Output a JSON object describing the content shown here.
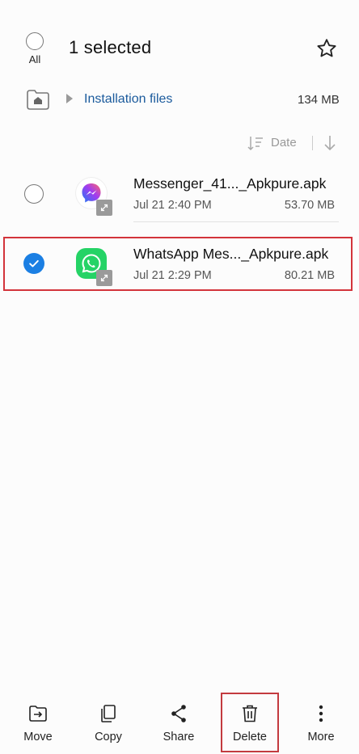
{
  "header": {
    "select_all_label": "All",
    "title": "1 selected"
  },
  "breadcrumb": {
    "folder": "Installation files",
    "size": "134 MB"
  },
  "sort": {
    "label": "Date"
  },
  "files": [
    {
      "name": "Messenger_41..._Apkpure.apk",
      "date": "Jul 21 2:40 PM",
      "size": "53.70 MB",
      "selected": false,
      "icon": "messenger-icon"
    },
    {
      "name": "WhatsApp Mes..._Apkpure.apk",
      "date": "Jul 21 2:29 PM",
      "size": "80.21 MB",
      "selected": true,
      "icon": "whatsapp-icon"
    }
  ],
  "bottom_bar": {
    "move": "Move",
    "copy": "Copy",
    "share": "Share",
    "delete": "Delete",
    "more": "More"
  },
  "colors": {
    "accent": "#1b7fe3",
    "link": "#1a5a9c",
    "highlight_box": "#d3343b",
    "whatsapp_green": "#25d366"
  }
}
